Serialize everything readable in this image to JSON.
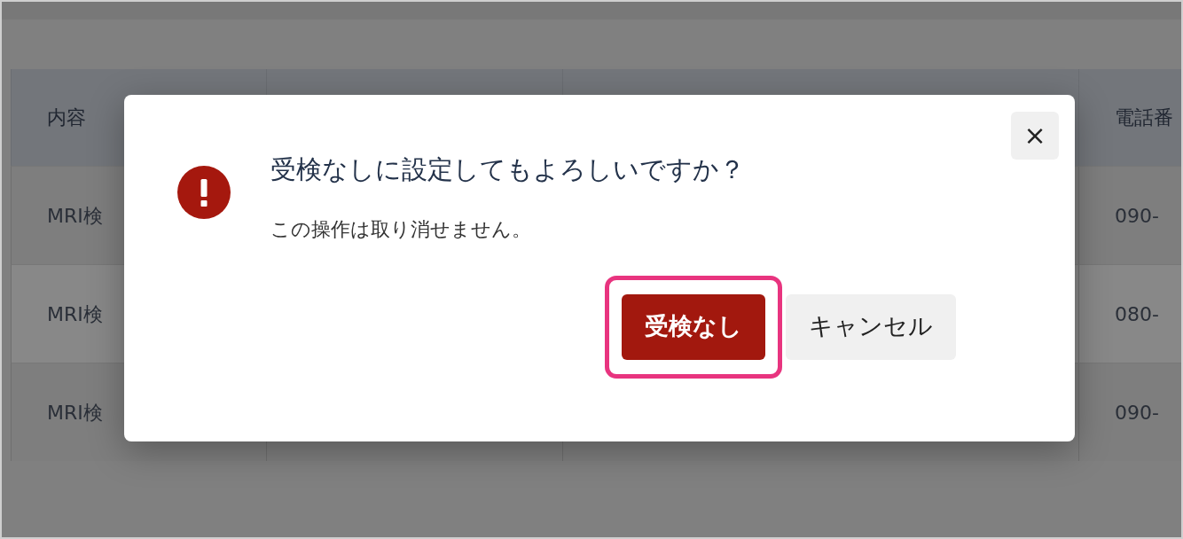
{
  "table": {
    "columns": [
      "内容",
      "",
      "",
      "電話番"
    ],
    "rows": [
      {
        "cells": [
          "MRI検",
          "",
          "",
          "090-"
        ]
      },
      {
        "cells": [
          "MRI検",
          "",
          "",
          "080-"
        ]
      },
      {
        "cells": [
          "MRI検",
          "",
          "",
          "090-"
        ]
      }
    ]
  },
  "dialog": {
    "title": "受検なしに設定してもよろしいですか？",
    "message": "この操作は取り消せません。",
    "close": "×",
    "actions": [
      {
        "label": "受検なし",
        "kind": "danger",
        "highlighted": true
      },
      {
        "label": "キャンセル",
        "kind": "secondary",
        "highlighted": false
      }
    ]
  }
}
